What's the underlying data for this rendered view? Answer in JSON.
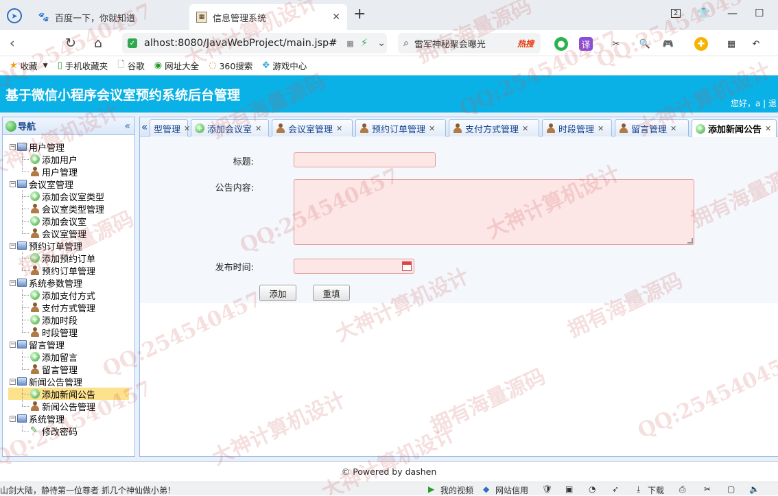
{
  "browser": {
    "tabs": [
      {
        "label": "百度一下，你就知道",
        "icon": "paw-icon",
        "active": false
      },
      {
        "label": "信息管理系统",
        "icon": "page-icon",
        "active": true
      }
    ],
    "new_tab": "+",
    "tab_count": "2",
    "url": "alhost:8080/JavaWebProject/main.jsp#",
    "search_text": "雷军神秘聚会曝光",
    "search_hot": "热搜",
    "bookmarks": [
      "收藏",
      "手机收藏夹",
      "谷歌",
      "网址大全",
      "360搜索",
      "游戏中心"
    ]
  },
  "app": {
    "title": "基于微信小程序会议室预约系统后台管理",
    "welcome": "您好，a | 退"
  },
  "sidebar": {
    "title": "导航",
    "groups": [
      {
        "label": "用户管理",
        "items": [
          {
            "label": "添加用户",
            "icon": "add"
          },
          {
            "label": "用户管理",
            "icon": "user"
          }
        ]
      },
      {
        "label": "会议室管理",
        "items": [
          {
            "label": "添加会议室类型",
            "icon": "add"
          },
          {
            "label": "会议室类型管理",
            "icon": "user"
          },
          {
            "label": "添加会议室",
            "icon": "add"
          },
          {
            "label": "会议室管理",
            "icon": "user"
          }
        ]
      },
      {
        "label": "预约订单管理",
        "items": [
          {
            "label": "添加预约订单",
            "icon": "add"
          },
          {
            "label": "预约订单管理",
            "icon": "user"
          }
        ]
      },
      {
        "label": "系统参数管理",
        "items": [
          {
            "label": "添加支付方式",
            "icon": "add"
          },
          {
            "label": "支付方式管理",
            "icon": "user"
          },
          {
            "label": "添加时段",
            "icon": "add"
          },
          {
            "label": "时段管理",
            "icon": "user"
          }
        ]
      },
      {
        "label": "留言管理",
        "items": [
          {
            "label": "添加留言",
            "icon": "add"
          },
          {
            "label": "留言管理",
            "icon": "user"
          }
        ]
      },
      {
        "label": "新闻公告管理",
        "items": [
          {
            "label": "添加新闻公告",
            "icon": "add",
            "selected": true
          },
          {
            "label": "新闻公告管理",
            "icon": "user"
          }
        ]
      },
      {
        "label": "系统管理",
        "items": [
          {
            "label": "修改密码",
            "icon": "pen"
          }
        ]
      }
    ]
  },
  "panel_tabs": [
    {
      "label": "型管理",
      "icon": "none"
    },
    {
      "label": "添加会议室",
      "icon": "add"
    },
    {
      "label": "会议室管理",
      "icon": "user"
    },
    {
      "label": "预约订单管理",
      "icon": "user"
    },
    {
      "label": "支付方式管理",
      "icon": "user"
    },
    {
      "label": "时段管理",
      "icon": "user"
    },
    {
      "label": "留言管理",
      "icon": "user"
    },
    {
      "label": "添加新闻公告",
      "icon": "add",
      "active": true
    }
  ],
  "form": {
    "title_label": "标题:",
    "content_label": "公告内容:",
    "time_label": "发布时间:",
    "title_value": "",
    "content_value": "",
    "time_value": "",
    "add_button": "添加",
    "reset_button": "重填"
  },
  "footer": "© Powered by dashen",
  "statusbar": {
    "left": "山剑大陆，静待第一位尊者 抓几个神仙做小弟！",
    "video": "我的视频",
    "credit": "网站信用",
    "download": "下载"
  },
  "watermarks": [
    "QQ:254540457",
    "大神计算机设计",
    "拥有海量源码"
  ]
}
